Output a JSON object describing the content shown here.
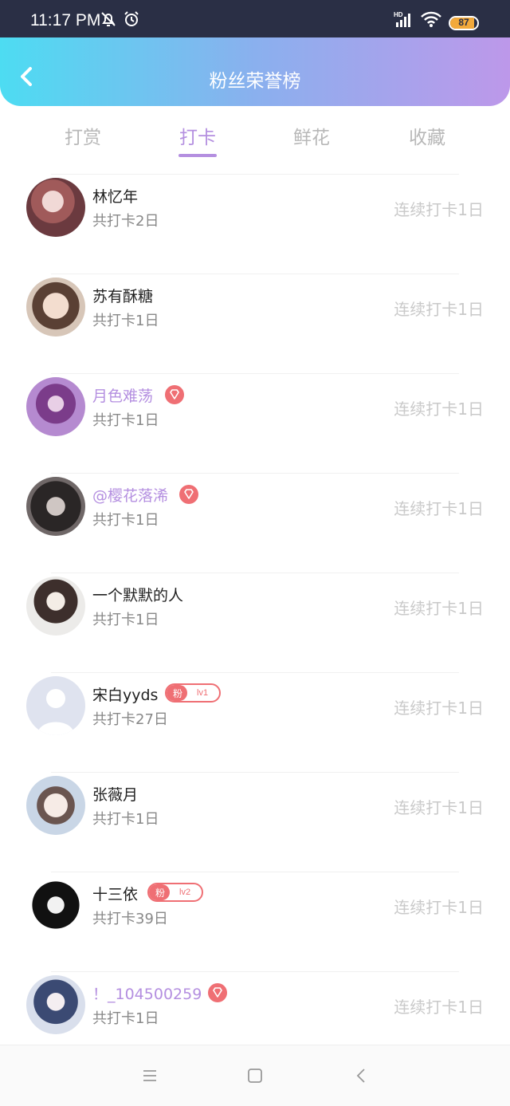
{
  "status_bar": {
    "time": "11:17 PM",
    "battery": "87"
  },
  "header": {
    "title": "粉丝荣誉榜"
  },
  "tabs": [
    {
      "label": "打赏",
      "active": false
    },
    {
      "label": "打卡",
      "active": true
    },
    {
      "label": "鲜花",
      "active": false
    },
    {
      "label": "收藏",
      "active": false
    }
  ],
  "rows": [
    {
      "name": "林忆年",
      "sub": "共打卡2日",
      "streak": "连续打卡1日",
      "badge": "none"
    },
    {
      "name": "苏有酥糖",
      "sub": "共打卡1日",
      "streak": "连续打卡1日",
      "badge": "none"
    },
    {
      "name": "月色难荡",
      "sub": "共打卡1日",
      "streak": "连续打卡1日",
      "badge": "gem"
    },
    {
      "name": "@樱花落浠",
      "sub": "共打卡1日",
      "streak": "连续打卡1日",
      "badge": "gem"
    },
    {
      "name": "一个默默的人",
      "sub": "共打卡1日",
      "streak": "连续打卡1日",
      "badge": "none"
    },
    {
      "name": "宋白yyds",
      "sub": "共打卡27日",
      "streak": "连续打卡1日",
      "badge": "fan",
      "fan_label": "粉",
      "level": "lv1"
    },
    {
      "name": "张薇月",
      "sub": "共打卡1日",
      "streak": "连续打卡1日",
      "badge": "none"
    },
    {
      "name": "十三依",
      "sub": "共打卡39日",
      "streak": "连续打卡1日",
      "badge": "fan",
      "fan_label": "粉",
      "level": "lv2"
    },
    {
      "name": "！_104500259",
      "sub": "共打卡1日",
      "streak": "连续打卡1日",
      "badge": "gem"
    }
  ],
  "colors": {
    "accent": "#b48fe0",
    "badge_red": "#ef6f74",
    "header_start": "#4ddcf2",
    "header_end": "#bd98ea"
  },
  "icons": {
    "back": "chevron-left-icon",
    "gem": "diamond-icon",
    "nav_menu": "menu-icon",
    "nav_home": "square-icon",
    "nav_back": "back-icon"
  }
}
